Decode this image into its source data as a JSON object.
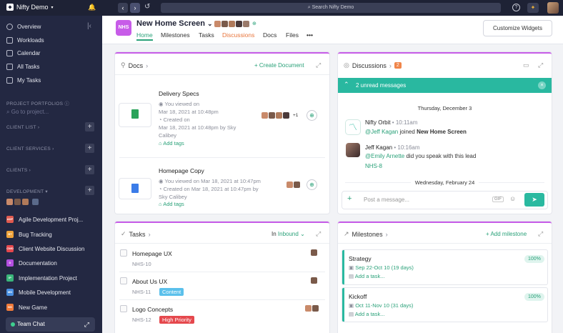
{
  "topbar": {
    "workspace": "Nifty Demo",
    "search_placeholder": "Search Nifty Demo"
  },
  "sidebar": {
    "items": [
      {
        "label": "Overview"
      },
      {
        "label": "Workloads"
      },
      {
        "label": "Calendar"
      },
      {
        "label": "All Tasks"
      },
      {
        "label": "My Tasks"
      }
    ],
    "portfolios_heading": "PROJECT PORTFOLIOS",
    "go_to_placeholder": "Go to project...",
    "groups": [
      "CLIENT LIST",
      "CLIENT SERVICES",
      "CLIENTS",
      "DEVELOPMENT"
    ],
    "projects": [
      {
        "abbr": "ADP",
        "label": "Agile Development Proj...",
        "color": "#e05a4f"
      },
      {
        "abbr": "BT",
        "label": "Bug Tracking",
        "color": "#f0a33a"
      },
      {
        "abbr": "CWD",
        "label": "Client Website Discussion",
        "color": "#e5484d"
      },
      {
        "abbr": "D",
        "label": "Documentation",
        "color": "#b34fe0"
      },
      {
        "abbr": "IP",
        "label": "Implementation Project",
        "color": "#3ab57a"
      },
      {
        "abbr": "MD",
        "label": "Mobile Development",
        "color": "#4a90e2"
      },
      {
        "abbr": "NG",
        "label": "New Game",
        "color": "#f07a3a"
      }
    ],
    "team_chat": "Team Chat"
  },
  "header": {
    "badge": "NHS",
    "title": "New Home Screen",
    "tabs": [
      "Home",
      "Milestones",
      "Tasks",
      "Discussions",
      "Docs",
      "Files"
    ],
    "more": "•••",
    "customize": "Customize Widgets"
  },
  "docs": {
    "title": "Docs",
    "action": "+ Create Document",
    "items": [
      {
        "name": "Delivery Specs",
        "viewed": "You viewed on",
        "viewed2": "Mar 18, 2021 at 10:48pm",
        "created": "Created on",
        "created2": "Mar 18, 2021 at 10:48pm by Sky",
        "created3": "Calibey",
        "tags": "Add tags",
        "extra": "+1"
      },
      {
        "name": "Homepage Copy",
        "viewed": "You viewed on Mar 18, 2021 at 10:47pm",
        "created": "Created on Mar 18, 2021 at 10:47pm by",
        "created2": "Sky Calibey",
        "tags": "Add tags"
      }
    ]
  },
  "discussions": {
    "title": "Discussions",
    "count": "2",
    "unread": "2 unread messages",
    "date1": "Thursday, December 3",
    "msg1": {
      "author": "Nifty Orbit",
      "time": "10:11am",
      "mention": "@Jeff Kagan",
      "text": "joined",
      "bold": "New Home Screen"
    },
    "msg2": {
      "author": "Jeff Kagan",
      "time": "10:16am",
      "mention": "@Emily Arnette",
      "text": "did you speak with this lead",
      "ref": "NHS-8"
    },
    "date2": "Wednesday, February 24",
    "input_placeholder": "Post a message...",
    "gif": "GIF"
  },
  "tasks": {
    "title": "Tasks",
    "filter_prefix": "In",
    "filter": "Inbound",
    "rows": [
      {
        "name": "Homepage UX",
        "id": "NHS-10",
        "tag": "",
        "tag_color": ""
      },
      {
        "name": "About Us UX",
        "id": "NHS-11",
        "tag": "Content",
        "tag_color": "#5bc0eb"
      },
      {
        "name": "Logo Concepts",
        "id": "NHS-12",
        "tag": "High Priority",
        "tag_color": "#e5484d"
      }
    ]
  },
  "milestones": {
    "title": "Milestones",
    "action": "+ Add milestone",
    "items": [
      {
        "name": "Strategy",
        "dates": "Sep 22-Oct 10 (19 days)",
        "add": "Add a task...",
        "percent": "100%"
      },
      {
        "name": "Kickoff",
        "dates": "Oct 11-Nov 10 (31 days)",
        "add": "Add a task...",
        "percent": "100%"
      }
    ]
  }
}
